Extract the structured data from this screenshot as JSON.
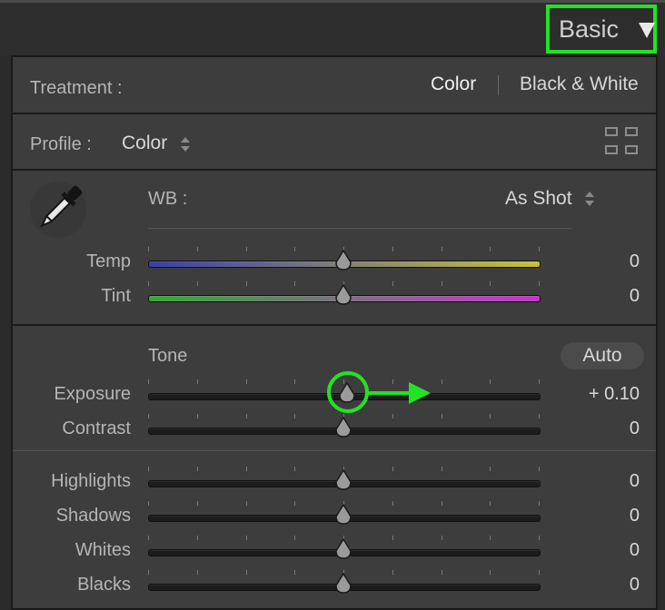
{
  "header": {
    "title": "Basic"
  },
  "treatment": {
    "label": "Treatment :",
    "options": [
      "Color",
      "Black & White"
    ]
  },
  "profile": {
    "label": "Profile :",
    "value": "Color"
  },
  "wb": {
    "label": "WB :",
    "value": "As Shot"
  },
  "wb_sliders": [
    {
      "label": "Temp",
      "value": "0",
      "position": 0.5
    },
    {
      "label": "Tint",
      "value": "0",
      "position": 0.5
    }
  ],
  "tone": {
    "label": "Tone",
    "auto_label": "Auto"
  },
  "tone_sliders": [
    {
      "label": "Exposure",
      "value": "+ 0.10",
      "position": 0.51
    },
    {
      "label": "Contrast",
      "value": "0",
      "position": 0.5
    }
  ],
  "presence_sliders": [
    {
      "label": "Highlights",
      "value": "0",
      "position": 0.5
    },
    {
      "label": "Shadows",
      "value": "0",
      "position": 0.5
    },
    {
      "label": "Whites",
      "value": "0",
      "position": 0.5
    },
    {
      "label": "Blacks",
      "value": "0",
      "position": 0.5
    }
  ],
  "colors": {
    "annotation": "#22e322",
    "temp_gradient": [
      "#3a3fb0",
      "#c8c23a"
    ],
    "tint_gradient": [
      "#3aa83a",
      "#c03ac8"
    ]
  }
}
